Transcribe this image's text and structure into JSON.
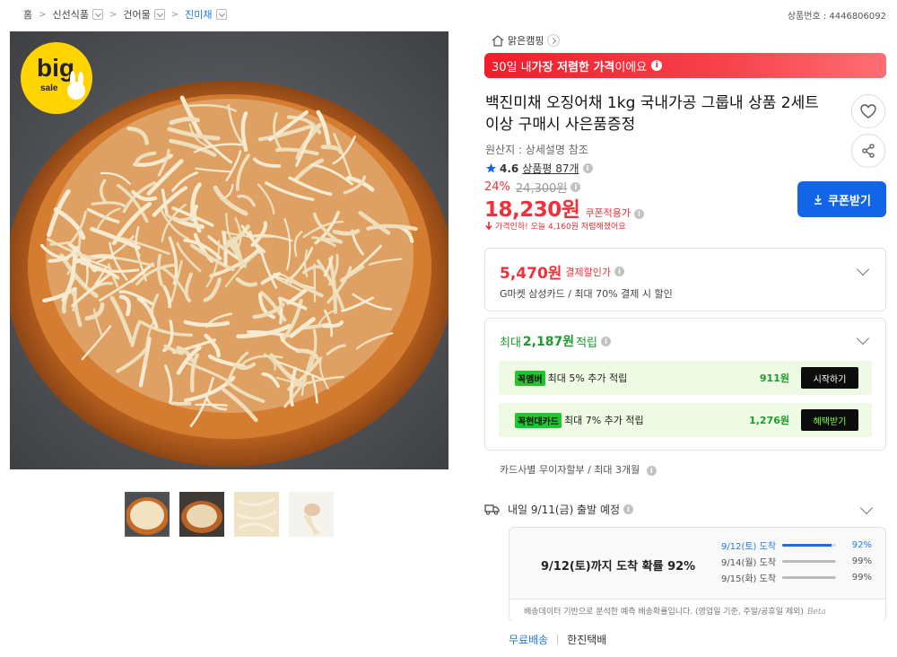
{
  "breadcrumb": {
    "items": [
      "홈",
      "신선식품",
      "건어물",
      "진미채"
    ]
  },
  "product_number": "상품번호 : 4446806092",
  "image": {
    "badge_big": "big",
    "badge_sale": "sale",
    "thumbnails_count": 4
  },
  "store": {
    "name": "맑은캠핑"
  },
  "low_price_banner": {
    "prefix": "30일 내 ",
    "emphasis": "가장 저렴한 가격",
    "suffix": "이에요"
  },
  "title": "백진미채 오징어채 1kg 국내가공 그룹내 상품 2세트 이상 구매시 사은품증정",
  "origin": "원산지 : 상세설명 참조",
  "rating": {
    "score": "4.6",
    "reviews": "상품평 87개"
  },
  "pricing": {
    "discount_pct": "24%",
    "original": "24,300원",
    "price": "18,230원",
    "price_label": "쿠폰적용가",
    "drop_notice": "가격인하! 오늘 4,160원 저렴해졌어요",
    "coupon_button": "쿠폰받기"
  },
  "payment_discount": {
    "amount": "5,470원",
    "label": "결제할인가",
    "desc": "G마켓 삼성카드 / 최대 70% 결제 시 할인"
  },
  "points": {
    "head_prefix": "최대",
    "head_amount": "2,187원",
    "head_suffix": "적립",
    "benefits": [
      {
        "tag": "꼭멤버",
        "text": "최대 5% 추가 적립",
        "won": "911원",
        "action": "시작하기"
      },
      {
        "tag": "꼭현대카드",
        "text": "최대 7% 추가 적립",
        "won": "1,276원",
        "action": "혜택받기"
      }
    ]
  },
  "installment": "카드사별 무이자할부 / 최대 3개월",
  "shipping": {
    "expected": "내일 9/11(금) 출발 예정",
    "headline": "9/12(토)까지 도착 확률 92%",
    "probabilities": [
      {
        "date": "9/12(토) 도착",
        "pct": "92%",
        "fill": 0.92
      },
      {
        "date": "9/14(월) 도착",
        "pct": "99%",
        "fill": 0.99
      },
      {
        "date": "9/15(화) 도착",
        "pct": "99%",
        "fill": 0.99
      }
    ],
    "note": "배송데이터 기반으로 분석한 예측 배송확률입니다. (영업일 기준, 주말/공휴일 제외)",
    "beta": "Beta",
    "fee": "무료배송",
    "courier": "한진택배"
  },
  "colors": {
    "accent_red": "#f0303a",
    "accent_blue": "#1265e6",
    "green": "#1a9b2c"
  }
}
